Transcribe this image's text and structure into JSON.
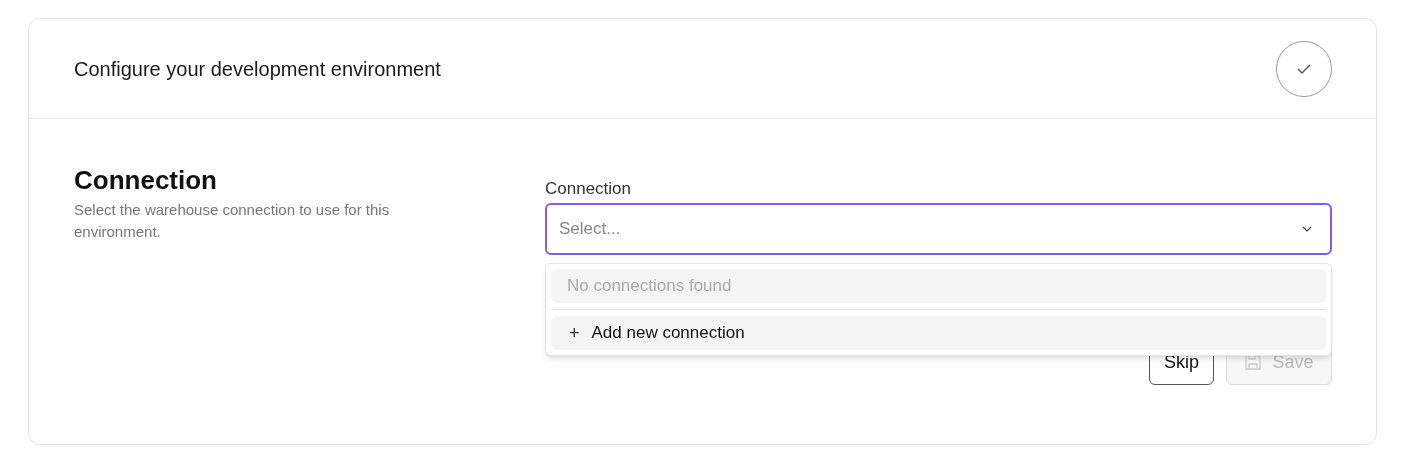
{
  "header": {
    "title": "Configure your development environment",
    "completed": true
  },
  "section": {
    "heading": "Connection",
    "description": "Select the warehouse connection to use for this environment."
  },
  "field": {
    "label": "Connection",
    "placeholder": "Select...",
    "focused": true,
    "expanded": true
  },
  "dropdown_items": [
    {
      "kind": "empty",
      "label": "No connections found"
    },
    {
      "kind": "action",
      "icon": "+",
      "label": "Add new connection"
    }
  ],
  "buttons": [
    {
      "label": "Skip",
      "disabled": false
    },
    {
      "label": "Save",
      "disabled": true
    }
  ]
}
